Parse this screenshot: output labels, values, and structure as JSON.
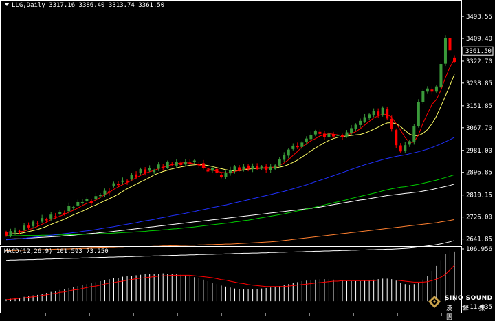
{
  "symbol_header": {
    "symbol": "LLG,Daily",
    "ohlc": "3317.16 3386.40 3313.74 3361.50"
  },
  "macd_header": {
    "label": "MACD(12,26,9) 101.593 73.250"
  },
  "logo": {
    "name": "SINO SOUND",
    "chinese": "漢 聲 集 團"
  },
  "colors": {
    "background": "#000000",
    "axis": "#ffffff",
    "bull_candle": "#3a9a3a",
    "bear_candle": "#ff0000",
    "ma5": "#ff0000",
    "ma10": "#ffff66",
    "ma30": "#2030ff",
    "ma60": "#00cc00",
    "ma90": "#ffffff",
    "ma200": "#ff8030",
    "macd_hist": "#ffffff",
    "macd_signal": "#ff0000"
  },
  "chart_data": [
    {
      "type": "candlestick",
      "title": "LLG,Daily",
      "ylim": [
        2625,
        3520
      ],
      "yticks": [
        3493.55,
        3409.4,
        3322.7,
        3238.85,
        3151.85,
        3067.7,
        2981.0,
        2896.85,
        2810.15,
        2726.0,
        2641.85
      ],
      "current_price": 3361.5,
      "candles_note": "open/close approximations, chronological",
      "open": [
        2667,
        2655,
        2666,
        2672,
        2677,
        2693,
        2691,
        2703,
        2708,
        2717,
        2720,
        2729,
        2736,
        2741,
        2748,
        2764,
        2770,
        2780,
        2788,
        2786,
        2793,
        2806,
        2813,
        2824,
        2844,
        2853,
        2860,
        2865,
        2871,
        2889,
        2895,
        2908,
        2903,
        2898,
        2911,
        2918,
        2914,
        2928,
        2923,
        2934,
        2927,
        2935,
        2936,
        2928,
        2932,
        2908,
        2903,
        2910,
        2888,
        2879,
        2893,
        2903,
        2916,
        2907,
        2923,
        2909,
        2920,
        2913,
        2919,
        2905,
        2910,
        2923,
        2945,
        2961,
        2986,
        2999,
        2994,
        3013,
        3024,
        3042,
        3052,
        3045,
        3032,
        3043,
        3036,
        3039,
        3034,
        3048,
        3064,
        3078,
        3091,
        3105,
        3117,
        3130,
        3115,
        3140,
        3102,
        3059,
        3000,
        2978,
        3003,
        3014,
        3073,
        3165,
        3206,
        3214,
        3206,
        3222,
        3313,
        3412,
        3336
      ],
      "close": [
        2655,
        2672,
        2674,
        2670,
        2693,
        2686,
        2708,
        2701,
        2722,
        2713,
        2735,
        2728,
        2745,
        2738,
        2769,
        2764,
        2783,
        2783,
        2795,
        2780,
        2806,
        2811,
        2826,
        2819,
        2855,
        2848,
        2865,
        2860,
        2887,
        2878,
        2909,
        2896,
        2912,
        2904,
        2927,
        2914,
        2936,
        2927,
        2936,
        2925,
        2938,
        2931,
        2942,
        2924,
        2913,
        2900,
        2913,
        2895,
        2879,
        2894,
        2906,
        2919,
        2905,
        2918,
        2910,
        2922,
        2909,
        2919,
        2905,
        2918,
        2924,
        2946,
        2962,
        2984,
        2999,
        2993,
        3011,
        3026,
        3041,
        3054,
        3044,
        3033,
        3045,
        3034,
        3040,
        3032,
        3050,
        3066,
        3079,
        3094,
        3108,
        3119,
        3133,
        3116,
        3144,
        3103,
        3062,
        3001,
        2977,
        3001,
        3016,
        3074,
        3165,
        3208,
        3218,
        3206,
        3226,
        3312,
        3410,
        3364,
        3320
      ],
      "ma5": [
        2668,
        2668,
        2668,
        2669,
        2672,
        2677,
        2683,
        2690,
        2698,
        2706,
        2716,
        2723,
        2729,
        2736,
        2744,
        2752,
        2760,
        2770,
        2778,
        2783,
        2791,
        2800,
        2812,
        2820,
        2832,
        2841,
        2850,
        2858,
        2866,
        2876,
        2885,
        2893,
        2899,
        2904,
        2911,
        2916,
        2922,
        2926,
        2930,
        2933,
        2934,
        2932,
        2930,
        2925,
        2920,
        2911,
        2905,
        2901,
        2897,
        2895,
        2896,
        2900,
        2904,
        2908,
        2912,
        2913,
        2914,
        2914,
        2915,
        2915,
        2918,
        2923,
        2933,
        2945,
        2962,
        2977,
        2994,
        3006,
        3018,
        3026,
        3036,
        3041,
        3045,
        3043,
        3040,
        3039,
        3040,
        3045,
        3053,
        3064,
        3078,
        3092,
        3105,
        3113,
        3120,
        3118,
        3108,
        3084,
        3058,
        3030,
        3011,
        3013,
        3041,
        3086,
        3122,
        3157,
        3176,
        3212,
        3260,
        3300,
        3330
      ],
      "ma10": [
        2660,
        2661,
        2662,
        2663,
        2666,
        2670,
        2674,
        2678,
        2684,
        2690,
        2697,
        2704,
        2711,
        2718,
        2726,
        2734,
        2741,
        2748,
        2756,
        2765,
        2772,
        2780,
        2788,
        2796,
        2804,
        2813,
        2824,
        2834,
        2843,
        2852,
        2860,
        2868,
        2877,
        2887,
        2894,
        2900,
        2905,
        2910,
        2914,
        2918,
        2921,
        2924,
        2926,
        2927,
        2926,
        2923,
        2919,
        2915,
        2911,
        2907,
        2904,
        2902,
        2903,
        2906,
        2909,
        2911,
        2912,
        2913,
        2913,
        2913,
        2914,
        2917,
        2921,
        2927,
        2935,
        2944,
        2955,
        2967,
        2979,
        2990,
        3000,
        3010,
        3019,
        3026,
        3031,
        3034,
        3036,
        3038,
        3040,
        3042,
        3047,
        3054,
        3062,
        3070,
        3079,
        3086,
        3087,
        3083,
        3072,
        3057,
        3043,
        3037,
        3038,
        3046,
        3061,
        3083,
        3112,
        3150,
        3190,
        3230,
        3272
      ],
      "ma30": [
        2639,
        2640,
        2641,
        2643,
        2644,
        2646,
        2648,
        2650,
        2652,
        2654,
        2656,
        2658,
        2660,
        2662,
        2664,
        2666,
        2668,
        2671,
        2673,
        2675,
        2678,
        2681,
        2684,
        2686,
        2689,
        2692,
        2695,
        2698,
        2701,
        2704,
        2708,
        2711,
        2714,
        2717,
        2721,
        2724,
        2727,
        2731,
        2734,
        2737,
        2740,
        2744,
        2747,
        2751,
        2754,
        2758,
        2762,
        2765,
        2769,
        2772,
        2776,
        2780,
        2784,
        2788,
        2792,
        2796,
        2800,
        2804,
        2808,
        2812,
        2816,
        2820,
        2824,
        2829,
        2834,
        2839,
        2844,
        2849,
        2855,
        2861,
        2866,
        2872,
        2878,
        2884,
        2890,
        2896,
        2902,
        2908,
        2914,
        2920,
        2926,
        2931,
        2936,
        2941,
        2946,
        2950,
        2954,
        2958,
        2961,
        2964,
        2968,
        2972,
        2976,
        2981,
        2986,
        2992,
        2999,
        3006,
        3014,
        3022,
        3031
      ],
      "ma60": [
        2654,
        2654,
        2654,
        2654,
        2655,
        2655,
        2655,
        2655,
        2656,
        2656,
        2656,
        2657,
        2657,
        2657,
        2658,
        2658,
        2659,
        2659,
        2660,
        2660,
        2661,
        2662,
        2662,
        2663,
        2664,
        2665,
        2666,
        2667,
        2668,
        2669,
        2670,
        2671,
        2673,
        2674,
        2675,
        2677,
        2678,
        2680,
        2681,
        2683,
        2685,
        2686,
        2688,
        2690,
        2692,
        2694,
        2696,
        2698,
        2700,
        2702,
        2704,
        2707,
        2709,
        2712,
        2714,
        2717,
        2720,
        2723,
        2726,
        2729,
        2732,
        2735,
        2738,
        2742,
        2745,
        2749,
        2752,
        2756,
        2760,
        2764,
        2768,
        2772,
        2776,
        2780,
        2784,
        2788,
        2792,
        2797,
        2801,
        2805,
        2809,
        2813,
        2817,
        2821,
        2826,
        2830,
        2834,
        2837,
        2840,
        2842,
        2845,
        2848,
        2851,
        2855,
        2859,
        2863,
        2867,
        2872,
        2877,
        2882,
        2888
      ],
      "ma90": [
        2641,
        2642,
        2643,
        2643,
        2644,
        2645,
        2646,
        2647,
        2648,
        2649,
        2650,
        2651,
        2652,
        2654,
        2655,
        2656,
        2658,
        2659,
        2661,
        2663,
        2664,
        2666,
        2668,
        2669,
        2671,
        2673,
        2675,
        2677,
        2679,
        2681,
        2683,
        2685,
        2687,
        2689,
        2691,
        2693,
        2695,
        2697,
        2699,
        2701,
        2703,
        2705,
        2707,
        2709,
        2711,
        2713,
        2715,
        2717,
        2719,
        2721,
        2723,
        2725,
        2727,
        2729,
        2731,
        2733,
        2735,
        2737,
        2739,
        2741,
        2743,
        2745,
        2747,
        2749,
        2751,
        2753,
        2755,
        2757,
        2759,
        2762,
        2764,
        2767,
        2770,
        2773,
        2776,
        2779,
        2782,
        2785,
        2788,
        2791,
        2793,
        2796,
        2799,
        2802,
        2805,
        2808,
        2810,
        2812,
        2814,
        2816,
        2818,
        2820,
        2822,
        2825,
        2828,
        2831,
        2835,
        2839,
        2843,
        2847,
        2852
      ],
      "ma200": [
        2597,
        2598,
        2598,
        2599,
        2599,
        2600,
        2600,
        2601,
        2601,
        2602,
        2602,
        2603,
        2603,
        2604,
        2604,
        2605,
        2605,
        2606,
        2606,
        2607,
        2607,
        2608,
        2608,
        2609,
        2609,
        2610,
        2610,
        2611,
        2611,
        2612,
        2612,
        2613,
        2613,
        2614,
        2614,
        2615,
        2615,
        2616,
        2616,
        2617,
        2617,
        2618,
        2618,
        2619,
        2619,
        2620,
        2620,
        2621,
        2621,
        2622,
        2622,
        2623,
        2624,
        2625,
        2626,
        2627,
        2628,
        2629,
        2630,
        2631,
        2632,
        2634,
        2636,
        2638,
        2640,
        2642,
        2644,
        2646,
        2648,
        2650,
        2652,
        2654,
        2656,
        2658,
        2660,
        2662,
        2664,
        2666,
        2668,
        2670,
        2672,
        2674,
        2676,
        2678,
        2680,
        2682,
        2684,
        2686,
        2688,
        2690,
        2692,
        2694,
        2696,
        2698,
        2700,
        2702,
        2704,
        2707,
        2710,
        2713,
        2716
      ],
      "ma250": [
        2560,
        2561,
        2561,
        2562,
        2562,
        2563,
        2563,
        2564,
        2564,
        2565,
        2565,
        2566,
        2566,
        2567,
        2567,
        2568,
        2568,
        2569,
        2569,
        2570,
        2570,
        2571,
        2571,
        2572,
        2572,
        2573,
        2573,
        2574,
        2574,
        2575,
        2575,
        2576,
        2576,
        2577,
        2577,
        2578,
        2578,
        2579,
        2579,
        2580,
        2580,
        2581,
        2581,
        2582,
        2582,
        2583,
        2583,
        2584,
        2584,
        2585,
        2585,
        2586,
        2586,
        2587,
        2587,
        2588,
        2588,
        2589,
        2589,
        2590,
        2590,
        2591,
        2591,
        2592,
        2592,
        2593,
        2593,
        2594,
        2594,
        2595,
        2595,
        2596,
        2596,
        2597,
        2597,
        2598,
        2598,
        2599,
        2599,
        2600,
        2600,
        2601,
        2601,
        2602,
        2602,
        2603,
        2603,
        2604,
        2605,
        2606,
        2607,
        2609,
        2611,
        2613,
        2615,
        2617,
        2620,
        2623,
        2627,
        2631,
        2636
      ]
    },
    {
      "type": "macd",
      "title": "MACD(12,26,9)",
      "macd": 101.593,
      "signal": 73.25,
      "ylim": [
        -11.035,
        106.956
      ],
      "yticks": [
        106.956,
        -11.035
      ],
      "histogram": [
        4,
        5,
        6,
        7,
        9,
        10,
        12,
        13,
        15,
        17,
        19,
        21,
        23,
        25,
        27,
        29,
        31,
        33,
        35,
        37,
        39,
        41,
        43,
        45,
        47,
        48,
        50,
        51,
        52,
        53,
        54,
        55,
        55,
        56,
        56,
        57,
        56,
        56,
        55,
        54,
        53,
        51,
        49,
        47,
        44,
        41,
        38,
        35,
        32,
        30,
        28,
        26,
        25,
        24,
        24,
        24,
        25,
        26,
        27,
        28,
        29,
        31,
        33,
        35,
        37,
        39,
        41,
        42,
        43,
        44,
        45,
        45,
        45,
        44,
        43,
        42,
        41,
        41,
        41,
        41,
        42,
        43,
        44,
        45,
        46,
        46,
        45,
        42,
        38,
        35,
        34,
        35,
        38,
        44,
        52,
        62,
        72,
        84,
        96,
        104,
        101.593
      ],
      "signal_line": [
        3,
        4,
        5,
        6,
        7,
        8,
        9,
        10,
        12,
        13,
        15,
        16,
        18,
        19,
        21,
        23,
        24,
        26,
        28,
        30,
        31,
        33,
        35,
        37,
        38,
        40,
        41,
        43,
        44,
        46,
        47,
        48,
        49,
        50,
        51,
        52,
        52,
        53,
        53,
        53,
        53,
        53,
        52,
        51,
        50,
        49,
        48,
        46,
        44,
        43,
        41,
        39,
        37,
        36,
        34,
        33,
        32,
        31,
        30,
        30,
        30,
        30,
        30,
        31,
        32,
        33,
        34,
        35,
        36,
        37,
        38,
        39,
        40,
        41,
        41,
        42,
        42,
        42,
        42,
        42,
        42,
        42,
        42,
        43,
        43,
        43,
        43,
        43,
        42,
        41,
        40,
        39,
        39,
        39,
        40,
        42,
        45,
        49,
        55,
        64,
        73.25
      ]
    }
  ]
}
